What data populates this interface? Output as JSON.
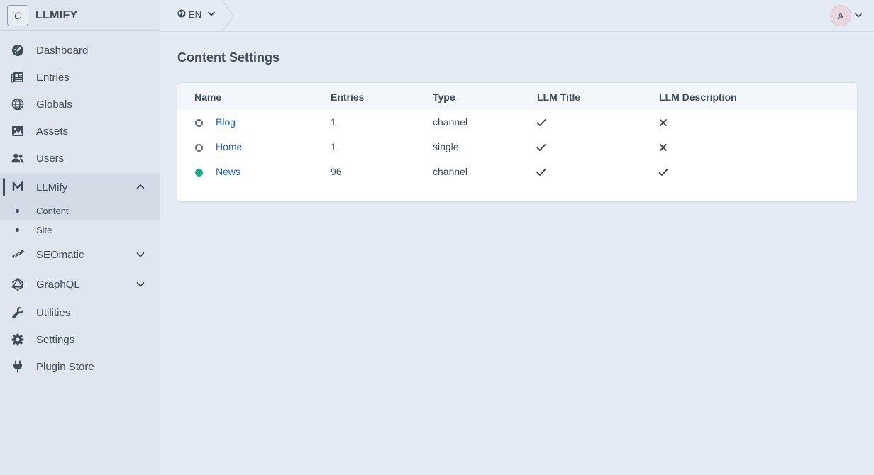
{
  "brand": {
    "logo_letter": "C",
    "name": "LLMIFY"
  },
  "nav": {
    "dashboard": "Dashboard",
    "entries": "Entries",
    "globals": "Globals",
    "assets": "Assets",
    "users": "Users",
    "llmify": "LLMify",
    "llmify_sub": {
      "content": "Content",
      "site": "Site"
    },
    "seomatic": "SEOmatic",
    "graphql": "GraphQL",
    "utilities": "Utilities",
    "settings": "Settings",
    "plugin_store": "Plugin Store"
  },
  "topbar": {
    "site_label": "EN",
    "avatar_letter": "A"
  },
  "page": {
    "title": "Content Settings"
  },
  "table": {
    "headers": {
      "name": "Name",
      "entries": "Entries",
      "type": "Type",
      "llm_title": "LLM Title",
      "llm_description": "LLM Description"
    },
    "rows": [
      {
        "status": "off",
        "name": "Blog",
        "entries": "1",
        "type": "channel",
        "llm_title": "check",
        "llm_description": "cross"
      },
      {
        "status": "off",
        "name": "Home",
        "entries": "1",
        "type": "single",
        "llm_title": "check",
        "llm_description": "cross"
      },
      {
        "status": "on",
        "name": "News",
        "entries": "96",
        "type": "channel",
        "llm_title": "check",
        "llm_description": "check"
      }
    ]
  },
  "colors": {
    "accent_link": "#1f5fbf",
    "status_on": "#1aa488",
    "sidebar_bg": "#dfe6ef",
    "page_bg": "#e4ebf5"
  }
}
